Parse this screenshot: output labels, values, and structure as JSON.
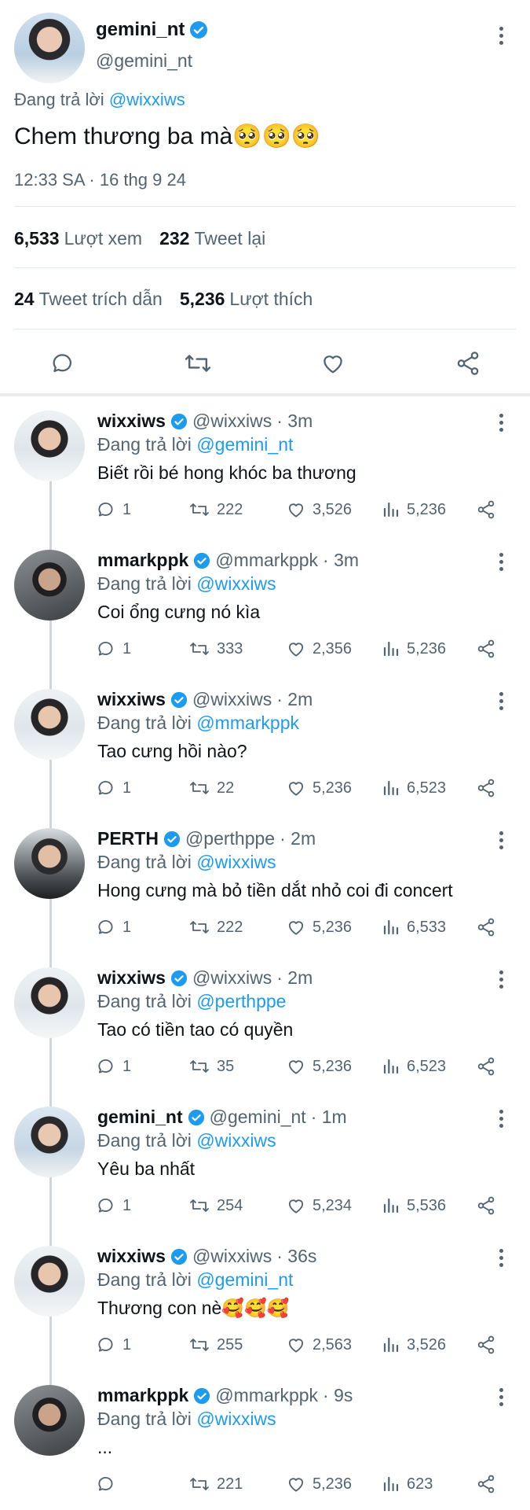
{
  "colors": {
    "accent": "#1d9bf0",
    "text": "#0f1419",
    "muted": "#536471",
    "divider": "#e1e8ed"
  },
  "main_tweet": {
    "name": "gemini_nt",
    "handle": "@gemini_nt",
    "reply_prefix": "Đang trả lời",
    "reply_to": "@wixxiws",
    "text": "Chem thương ba mà🥺🥺🥺",
    "timestamp": "12:33 SA · 16 thg 9 24",
    "views_count": "6,533",
    "views_label": "Lượt xem",
    "retweets_count": "232",
    "retweets_label": "Tweet lại",
    "quotes_count": "24",
    "quotes_label": "Tweet trích dẫn",
    "likes_count": "5,236",
    "likes_label": "Lượt thích",
    "icons": [
      "reply-icon",
      "retweet-icon",
      "like-icon",
      "share-icon"
    ]
  },
  "replies": [
    {
      "name": "wixxiws",
      "handle": "@wixxiws",
      "time": "· 3m",
      "reply_prefix": "Đang trả lời",
      "reply_to": "@gemini_nt",
      "text": "Biết rồi bé hong khóc ba thương",
      "replies": "1",
      "retweets": "222",
      "likes": "3,526",
      "views": "5,236"
    },
    {
      "name": "mmarkppk",
      "handle": "@mmarkppk",
      "time": "· 3m",
      "reply_prefix": "Đang trả lời",
      "reply_to": "@wixxiws",
      "text": "Coi ổng cưng nó kìa",
      "replies": "1",
      "retweets": "333",
      "likes": "2,356",
      "views": "5,236"
    },
    {
      "name": "wixxiws",
      "handle": "@wixxiws",
      "time": "· 2m",
      "reply_prefix": "Đang trả lời",
      "reply_to": "@mmarkppk",
      "text": "Tao cưng hồi nào?",
      "replies": "1",
      "retweets": "22",
      "likes": "5,236",
      "views": "6,523"
    },
    {
      "name": "PERTH",
      "handle": "@perthppe",
      "time": "· 2m",
      "reply_prefix": "Đang trả lời",
      "reply_to": "@wixxiws",
      "text": "Hong cưng mà bỏ tiền dắt nhỏ coi đi concert",
      "replies": "1",
      "retweets": "222",
      "likes": "5,236",
      "views": "6,533"
    },
    {
      "name": "wixxiws",
      "handle": "@wixxiws",
      "time": "· 2m",
      "reply_prefix": "Đang trả lời",
      "reply_to": "@perthppe",
      "text": "Tao có tiền tao có quyền",
      "replies": "1",
      "retweets": "35",
      "likes": "5,236",
      "views": "6,523"
    },
    {
      "name": "gemini_nt",
      "handle": "@gemini_nt",
      "time": "· 1m",
      "reply_prefix": "Đang trả lời",
      "reply_to": "@wixxiws",
      "text": "Yêu ba nhất",
      "replies": "1",
      "retweets": "254",
      "likes": "5,234",
      "views": "5,536"
    },
    {
      "name": "wixxiws",
      "handle": "@wixxiws",
      "time": "· 36s",
      "reply_prefix": "Đang trả lời",
      "reply_to": "@gemini_nt",
      "text": "Thương con nè🥰🥰🥰",
      "replies": "1",
      "retweets": "255",
      "likes": "2,563",
      "views": "3,526"
    },
    {
      "name": "mmarkppk",
      "handle": "@mmarkppk",
      "time": "· 9s",
      "reply_prefix": "Đang trả lời",
      "reply_to": "@wixxiws",
      "text": "...",
      "replies": "",
      "retweets": "221",
      "likes": "5,236",
      "views": "623"
    }
  ]
}
